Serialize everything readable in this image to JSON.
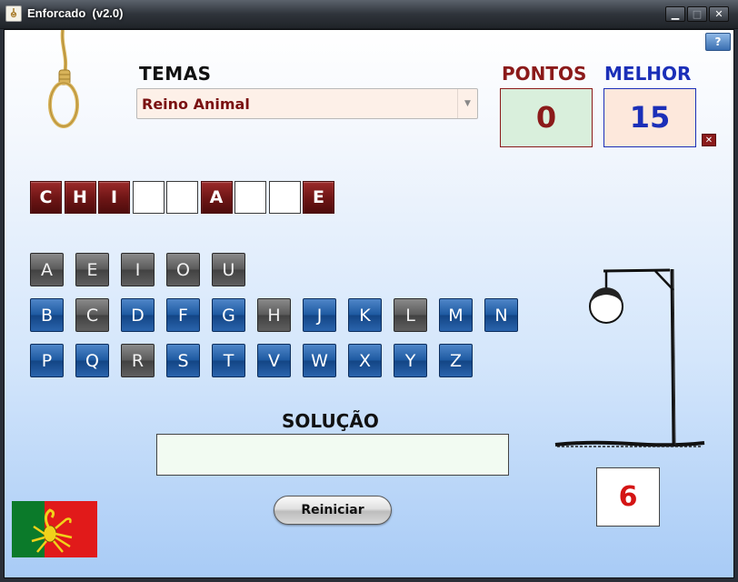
{
  "window": {
    "title": "Enforcado  (v2.0)",
    "minimize": "▁",
    "maximize": "□",
    "close": "✕"
  },
  "help": {
    "label": "?"
  },
  "theme": {
    "label": "TEMAS",
    "selected": "Reino Animal"
  },
  "score": {
    "points_label": "PONTOS",
    "points": "0",
    "best_label": "MELHOR",
    "best": "15",
    "reset_label": "✕"
  },
  "word": {
    "slots": [
      "C",
      "H",
      "I",
      "",
      "",
      "A",
      "",
      "",
      "E"
    ]
  },
  "keyboard": {
    "rows": [
      [
        {
          "letter": "A",
          "used": true
        },
        {
          "letter": "E",
          "used": true
        },
        {
          "letter": "I",
          "used": true
        },
        {
          "letter": "O",
          "used": true
        },
        {
          "letter": "U",
          "used": true
        }
      ],
      [
        {
          "letter": "B",
          "used": false
        },
        {
          "letter": "C",
          "used": true
        },
        {
          "letter": "D",
          "used": false
        },
        {
          "letter": "F",
          "used": false
        },
        {
          "letter": "G",
          "used": false
        },
        {
          "letter": "H",
          "used": true
        },
        {
          "letter": "J",
          "used": false
        },
        {
          "letter": "K",
          "used": false
        },
        {
          "letter": "L",
          "used": true
        },
        {
          "letter": "M",
          "used": false
        },
        {
          "letter": "N",
          "used": false
        }
      ],
      [
        {
          "letter": "P",
          "used": false
        },
        {
          "letter": "Q",
          "used": false
        },
        {
          "letter": "R",
          "used": true
        },
        {
          "letter": "S",
          "used": false
        },
        {
          "letter": "T",
          "used": false
        },
        {
          "letter": "V",
          "used": false
        },
        {
          "letter": "W",
          "used": false
        },
        {
          "letter": "X",
          "used": false
        },
        {
          "letter": "Y",
          "used": false
        },
        {
          "letter": "Z",
          "used": false
        }
      ]
    ]
  },
  "solution": {
    "label": "SOLUÇÃO",
    "value": ""
  },
  "restart": {
    "label": "Reiniciar"
  },
  "lives": {
    "remaining": "6"
  },
  "colors": {
    "filled_slot": "#701616",
    "key_available": "#1e5aa2",
    "key_used": "#5b5b5b",
    "points": "#8b1a1a",
    "best": "#1b2fb8",
    "lives": "#d41414"
  },
  "icons": [
    "noose-icon",
    "gallows-icon",
    "portugal-flag-icon",
    "app-icon"
  ]
}
